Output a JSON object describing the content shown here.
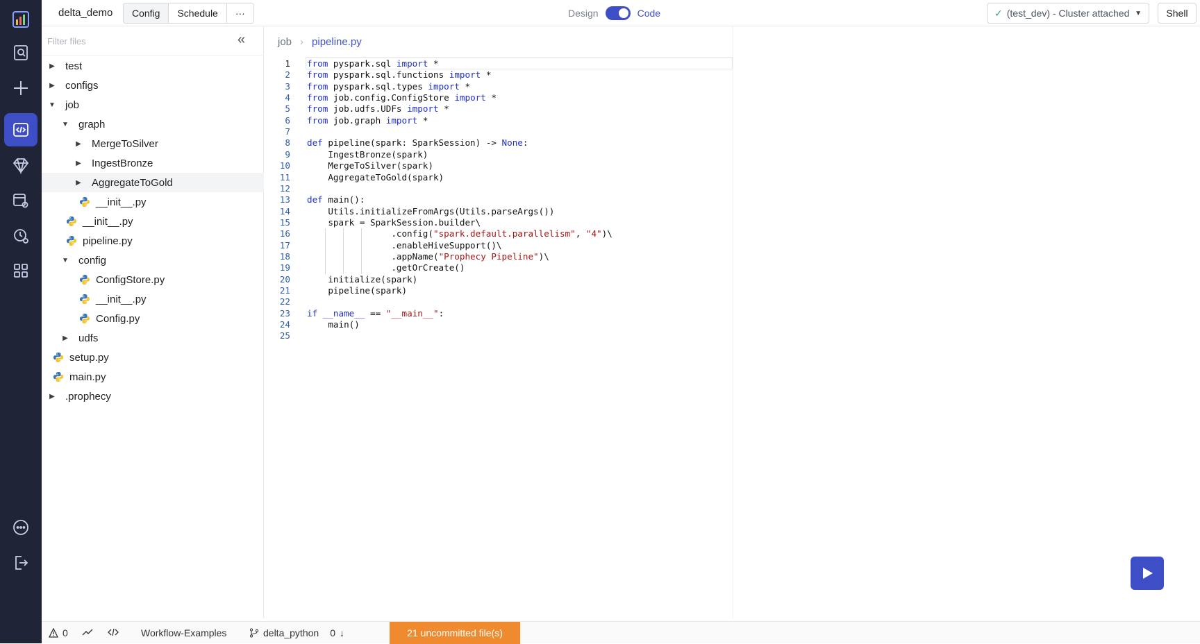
{
  "app": {
    "project_name": "delta_demo",
    "tabs": {
      "config": "Config",
      "schedule": "Schedule",
      "more": "···"
    },
    "mode": {
      "design": "Design",
      "code": "Code",
      "code_enabled": true
    },
    "cluster": {
      "label": "(test_dev) - Cluster attached"
    },
    "shell": "Shell"
  },
  "rail": [
    "logo-icon",
    "search-docs-icon",
    "plus-icon",
    "code-editor-icon",
    "gem-icon",
    "table-settings-icon",
    "clock-settings-icon",
    "grid-icon",
    "more-icon",
    "logout-icon"
  ],
  "filetree": {
    "filter_placeholder": "Filter files",
    "nodes": [
      {
        "label": "test",
        "type": "folder",
        "expanded": false,
        "depth": 0
      },
      {
        "label": "configs",
        "type": "folder",
        "expanded": false,
        "depth": 0
      },
      {
        "label": "job",
        "type": "folder",
        "expanded": true,
        "depth": 0
      },
      {
        "label": "graph",
        "type": "folder",
        "expanded": true,
        "depth": 1
      },
      {
        "label": "MergeToSilver",
        "type": "folder",
        "expanded": false,
        "depth": 2
      },
      {
        "label": "IngestBronze",
        "type": "folder",
        "expanded": false,
        "depth": 2
      },
      {
        "label": "AggregateToGold",
        "type": "folder",
        "expanded": false,
        "depth": 2,
        "hover": true
      },
      {
        "label": "__init__.py",
        "type": "py",
        "depth": 2
      },
      {
        "label": "__init__.py",
        "type": "py",
        "depth": 1
      },
      {
        "label": "pipeline.py",
        "type": "py",
        "depth": 1
      },
      {
        "label": "config",
        "type": "folder",
        "expanded": true,
        "depth": 1
      },
      {
        "label": "ConfigStore.py",
        "type": "py",
        "depth": 2
      },
      {
        "label": "__init__.py",
        "type": "py",
        "depth": 2
      },
      {
        "label": "Config.py",
        "type": "py",
        "depth": 2
      },
      {
        "label": "udfs",
        "type": "folder",
        "expanded": false,
        "depth": 1
      },
      {
        "label": "setup.py",
        "type": "py",
        "depth": 0
      },
      {
        "label": "main.py",
        "type": "py",
        "depth": 0
      },
      {
        "label": ".prophecy",
        "type": "folder",
        "expanded": false,
        "depth": 0
      }
    ]
  },
  "breadcrumb": {
    "parent": "job",
    "file": "pipeline.py"
  },
  "code_lines": [
    "from pyspark.sql import *",
    "from pyspark.sql.functions import *",
    "from pyspark.sql.types import *",
    "from job.config.ConfigStore import *",
    "from job.udfs.UDFs import *",
    "from job.graph import *",
    "",
    "def pipeline(spark: SparkSession) -> None:",
    "    IngestBronze(spark)",
    "    MergeToSilver(spark)",
    "    AggregateToGold(spark)",
    "",
    "def main():",
    "    Utils.initializeFromArgs(Utils.parseArgs())",
    "    spark = SparkSession.builder\\",
    "                .config(\"spark.default.parallelism\", \"4\")\\",
    "                .enableHiveSupport()\\",
    "                .appName(\"Prophecy Pipeline\")\\",
    "                .getOrCreate()",
    "    initialize(spark)",
    "    pipeline(spark)",
    "",
    "if __name__ == \"__main__\":",
    "    main()",
    ""
  ],
  "status": {
    "warnings": "0",
    "repo": "Workflow-Examples",
    "branch": "delta_python",
    "behind": "0",
    "uncommitted": "21 uncommitted file(s)"
  },
  "colors": {
    "accent": "#3e4ec7",
    "rail_bg": "#1f2437",
    "uncommitted_bg": "#ef8a2e"
  }
}
